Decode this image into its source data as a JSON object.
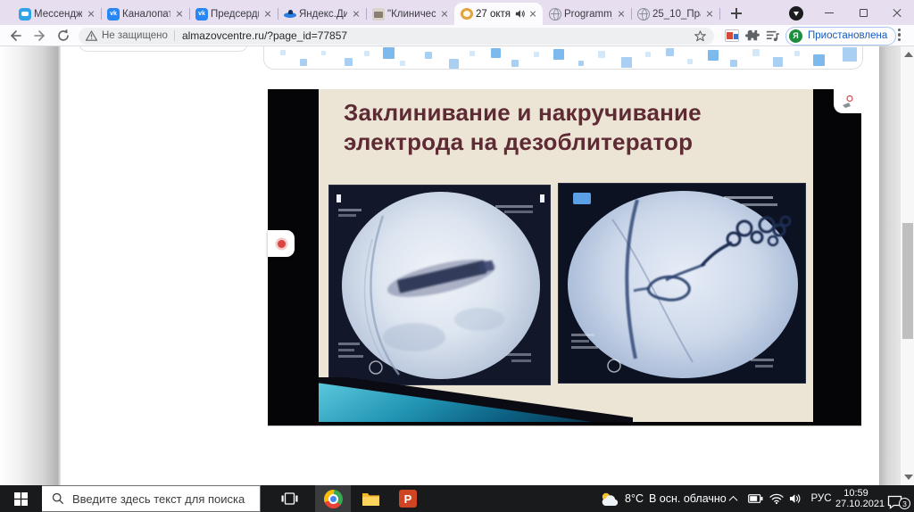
{
  "browser": {
    "tabs": [
      {
        "title": "Мессендже",
        "icon": "messenger-icon"
      },
      {
        "title": "Каналопат",
        "icon": "vk-icon"
      },
      {
        "title": "Предсердн",
        "icon": "vk-icon"
      },
      {
        "title": "Яндекс.Дис",
        "icon": "yandex-disk-icon"
      },
      {
        "title": "\"Клиничес",
        "icon": "image-icon"
      },
      {
        "title": "27 октя",
        "icon": "ring-icon",
        "state": "active, audio playing"
      },
      {
        "title": "Programm_",
        "icon": "globe-icon"
      },
      {
        "title": "25_10_Пра",
        "icon": "globe-icon"
      }
    ],
    "toolbar": {
      "security_label": "Не защищено",
      "url": "almazovcentre.ru/?page_id=77857",
      "profile_pill_label": "Приостановлена",
      "profile_avatar_letter": "Я"
    }
  },
  "icons": {
    "vk_glyph": "vk",
    "powerpoint_glyph": "P"
  },
  "page_content": {
    "slide": {
      "title_line1": "Заклинивание и накручивание",
      "title_line2": "электрода на дезоблитератор"
    }
  },
  "taskbar": {
    "search_placeholder": "Введите здесь текст для поиска",
    "weather_temperature": "8°C",
    "weather_condition": "В осн. облачно",
    "language_indicator": "РУС",
    "clock_time": "10:59",
    "clock_date": "27.10.2021",
    "notification_badge": "3"
  }
}
